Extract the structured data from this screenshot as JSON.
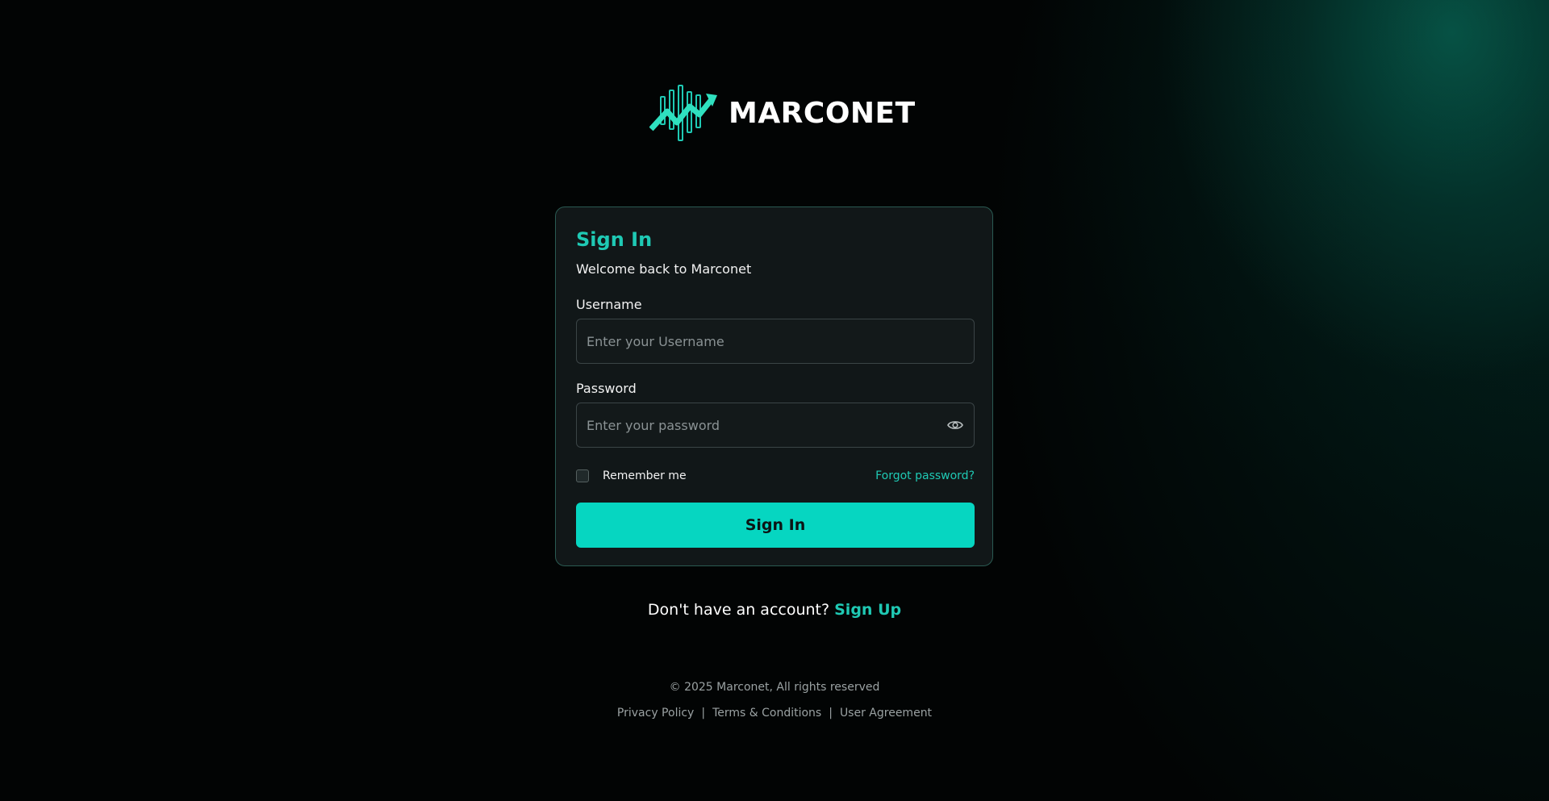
{
  "brand": {
    "name": "MARCONET",
    "accent_color": "#1fc9b4",
    "logo_icon": "chart-bars-arrow-icon"
  },
  "card": {
    "title": "Sign In",
    "subtitle": "Welcome back to Marconet",
    "username": {
      "label": "Username",
      "placeholder": "Enter your Username",
      "value": ""
    },
    "password": {
      "label": "Password",
      "placeholder": "Enter your password",
      "value": "",
      "toggle_icon": "eye-icon"
    },
    "remember_label": "Remember me",
    "remember_checked": false,
    "forgot_label": "Forgot password?",
    "submit_label": "Sign In",
    "button_color": "#06d6c1"
  },
  "signup": {
    "prompt": "Don't have an account?",
    "link_label": "Sign Up"
  },
  "footer": {
    "copyright": "© 2025 Marconet, All rights reserved",
    "links": [
      "Privacy Policy",
      "Terms & Conditions",
      "User Agreement"
    ],
    "separator": "|"
  }
}
